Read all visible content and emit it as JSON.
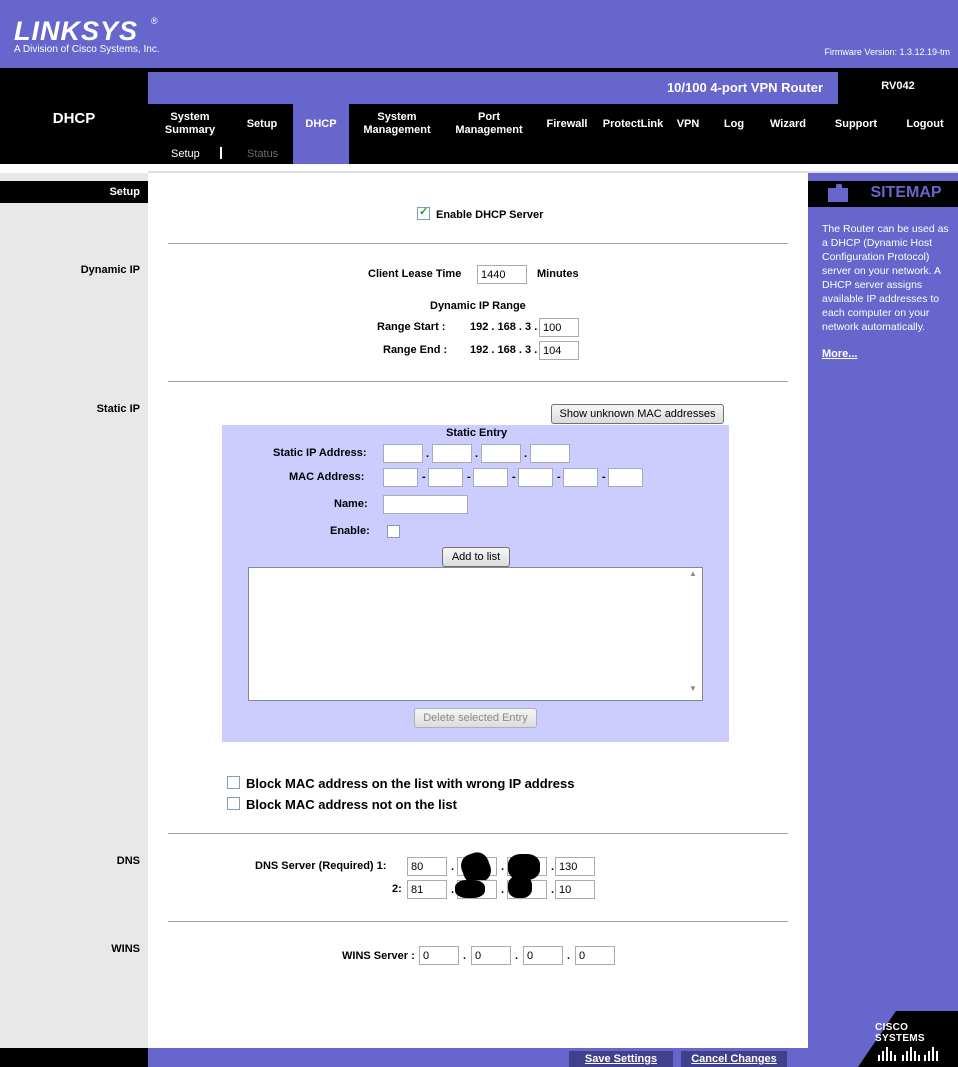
{
  "brand": {
    "logo": "LINKSYS",
    "reg": "®",
    "subtitle": "A Division of Cisco Systems, Inc.",
    "firmware": "Firmware Version: 1.3.12.19-tm"
  },
  "page_title": "DHCP",
  "product": {
    "name": "10/100 4-port VPN Router",
    "model": "RV042"
  },
  "nav": [
    {
      "label": "System Summary"
    },
    {
      "label": "Setup"
    },
    {
      "label": "DHCP"
    },
    {
      "label": "System Management"
    },
    {
      "label": "Port Management"
    },
    {
      "label": "Firewall"
    },
    {
      "label": "ProtectLink"
    },
    {
      "label": "VPN"
    },
    {
      "label": "Log"
    },
    {
      "label": "Wizard"
    },
    {
      "label": "Support"
    },
    {
      "label": "Logout"
    }
  ],
  "subnav": {
    "setup": "Setup",
    "status": "Status"
  },
  "sections": {
    "setup": "Setup",
    "dynamic_ip": "Dynamic IP",
    "static_ip": "Static IP",
    "dns": "DNS",
    "wins": "WINS"
  },
  "dhcp": {
    "enable_label": "Enable DHCP Server",
    "enabled": true
  },
  "dynamic": {
    "lease_label": "Client Lease Time",
    "lease_value": "1440",
    "lease_unit": "Minutes",
    "range_title": "Dynamic IP Range",
    "start_label": "Range Start :",
    "start_prefix": "192 . 168 . 3 .",
    "start_value": "100",
    "end_label": "Range End :",
    "end_prefix": "192 . 168 . 3 .",
    "end_value": "104"
  },
  "static": {
    "show_unknown_button": "Show unknown MAC addresses",
    "panel_title": "Static Entry",
    "ip_label": "Static IP Address:",
    "mac_label": "MAC Address:",
    "name_label": "Name:",
    "enable_label": "Enable:",
    "add_button": "Add to list",
    "delete_button": "Delete selected Entry"
  },
  "block": {
    "wrong_ip": "Block MAC address on the list with wrong IP address",
    "not_on_list": "Block MAC address not on the list"
  },
  "dns": {
    "label1": "DNS Server (Required) 1:",
    "label2": "2:",
    "server1": [
      "80",
      "",
      "",
      "130"
    ],
    "server2": [
      "81",
      "",
      "",
      "10"
    ]
  },
  "wins": {
    "label": "WINS Server :",
    "values": [
      "0",
      "0",
      "0",
      "0"
    ]
  },
  "sitemap": {
    "title": "SITEMAP",
    "text": "The Router can be used as a DHCP (Dynamic Host Configuration Protocol) server on your network. A DHCP server assigns available IP addresses to each computer on your network automatically.",
    "more": "More..."
  },
  "cisco": "CISCO SYSTEMS",
  "footer": {
    "save": "Save Settings",
    "cancel": "Cancel Changes"
  },
  "colors": {
    "brand_purple": "#6666cc",
    "panel_lavender": "#ccccff",
    "black": "#000000"
  }
}
